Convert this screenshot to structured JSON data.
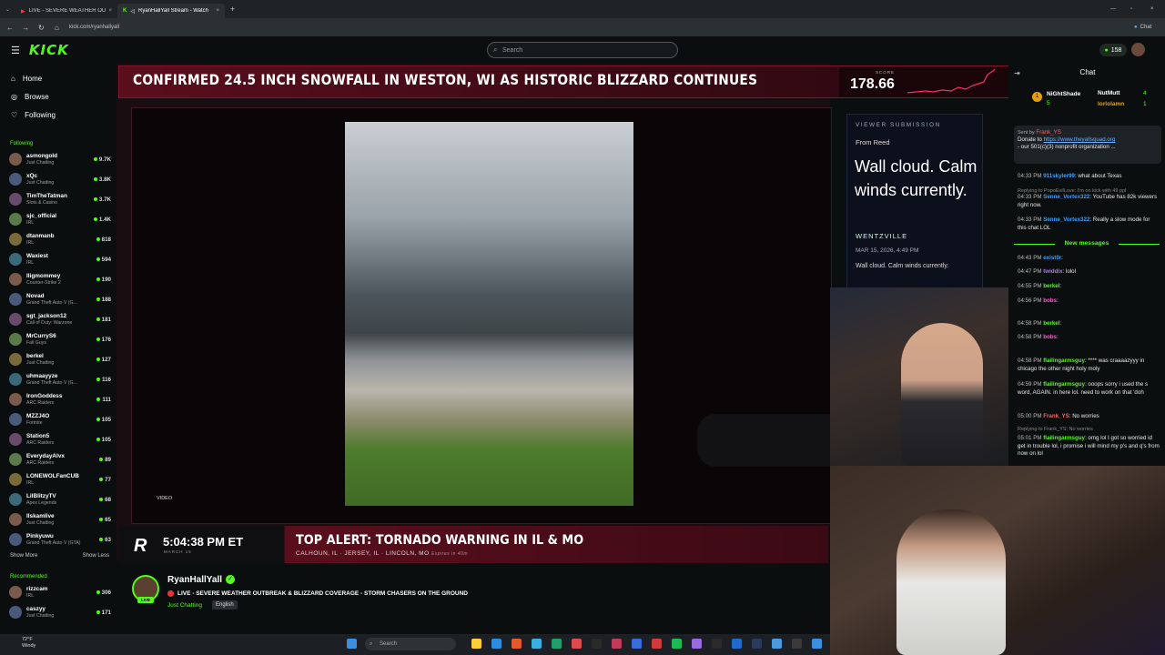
{
  "browser": {
    "tabs": [
      {
        "label": "LIVE - SEVERE WEATHER OUTB",
        "active": false
      },
      {
        "label": "RyanHallYall Stream - Watch",
        "active": true
      }
    ],
    "url": "kick.com/ryanhallyall",
    "chat_btn": "Chat"
  },
  "header": {
    "logo": "KICK",
    "search_placeholder": "Search",
    "points": "158"
  },
  "nav": {
    "home": "Home",
    "browse": "Browse",
    "following": "Following"
  },
  "sidebar": {
    "following_title": "Following",
    "following": [
      {
        "name": "asmongold",
        "cat": "Just Chatting",
        "count": "9.7K"
      },
      {
        "name": "xQc",
        "cat": "Just Chatting",
        "count": "3.8K"
      },
      {
        "name": "TimTheTatman",
        "cat": "Slots & Casino",
        "count": "3.7K"
      },
      {
        "name": "sjc_official",
        "cat": "IRL",
        "count": "1.4K"
      },
      {
        "name": "dtanmanb",
        "cat": "IRL",
        "count": "818"
      },
      {
        "name": "Waxiest",
        "cat": "IRL",
        "count": "594"
      },
      {
        "name": "lligmommey",
        "cat": "Counter-Strike 2",
        "count": "190"
      },
      {
        "name": "Novad",
        "cat": "Grand Theft Auto V (G...",
        "count": "188"
      },
      {
        "name": "sgt_jackson12",
        "cat": "Call of Duty: Warzone",
        "count": "181"
      },
      {
        "name": "MrCurryS6",
        "cat": "Fall Guys",
        "count": "176"
      },
      {
        "name": "berkel",
        "cat": "Just Chatting",
        "count": "127"
      },
      {
        "name": "uhmaayyze",
        "cat": "Grand Theft Auto V (G...",
        "count": "116"
      },
      {
        "name": "IronGoddess",
        "cat": "ARC Raiders",
        "count": "111"
      },
      {
        "name": "MZZJ4O",
        "cat": "Fortnite",
        "count": "105"
      },
      {
        "name": "Station5",
        "cat": "ARC Raiders",
        "count": "105"
      },
      {
        "name": "EverydayAlvx",
        "cat": "ARC Raiders",
        "count": "89"
      },
      {
        "name": "LONEWOLFanCUB",
        "cat": "IRL",
        "count": "77"
      },
      {
        "name": "LilBlitzyTV",
        "cat": "Apex Legends",
        "count": "68"
      },
      {
        "name": "llskamlive",
        "cat": "Just Chatting",
        "count": "65"
      },
      {
        "name": "Pinkyuwu",
        "cat": "Grand Theft Auto V (GTA)",
        "count": "63"
      }
    ],
    "show_more": "Show More",
    "show_less": "Show Less",
    "recommended_title": "Recommended",
    "recommended": [
      {
        "name": "rizzcam",
        "cat": "IRL",
        "count": "306"
      },
      {
        "name": "caszyy",
        "cat": "Just Chatting",
        "count": "171"
      }
    ]
  },
  "stream": {
    "headline": "CONFIRMED 24.5 INCH SNOWFALL IN WESTON, WI AS HISTORIC BLIZZARD CONTINUES",
    "score_label": "SCORE",
    "score": "178.66",
    "video_label": "VIDEO",
    "submission": {
      "header": "VIEWER SUBMISSION",
      "from": "From Reed",
      "big": "Wall cloud. Calm winds currently.",
      "location": "WENTZVILLE",
      "date": "MAR 15, 2026, 4:49 PM",
      "small": "Wall cloud. Calm winds currently."
    },
    "ticker": {
      "logo": "R",
      "time": "5:04:38 PM ET",
      "date": "MARCH 15",
      "alert": "TOP ALERT: TORNADO WARNING IN IL & MO",
      "places": "CALHOUN, IL · JERSEY, IL · LINCOLN, MO",
      "expires": "Expires in 40m"
    }
  },
  "streamer": {
    "name": "RyanHallYall",
    "live": "LIVE",
    "title": "LIVE - SEVERE WEATHER OUTBREAK & BLIZZARD COVERAGE - STORM CHASERS ON THE GROUND",
    "category": "Just Chatting",
    "language": "English"
  },
  "chat": {
    "title": "Chat",
    "leaderboard": [
      {
        "rank": "1",
        "name": "NiGhtShade",
        "count": "5"
      },
      {
        "name": "NutMutt",
        "count": "4"
      },
      {
        "name": "lorlolamn",
        "count": "1"
      }
    ],
    "pinned": {
      "sent_by": "Sent by",
      "user": "Frank_YS",
      "text1": "Donate to",
      "link": "https://www.theyallsquad.org",
      "text2": "- our 501(c)(3) nonprofit organization ..."
    },
    "new_messages": "New messages",
    "messages": [
      {
        "time": "04:33 PM",
        "user": "911skyler99",
        "color": "#3aa0ff",
        "text": ": what about Texas"
      },
      {
        "reply": "Replying to PopoEvilLove: I'm on kick with 49 ppl"
      },
      {
        "time": "04:33 PM",
        "user": "Senne_Vortex322",
        "color": "#3aa0ff",
        "text": ": YouTube has 82k viewers right now."
      },
      {
        "time": "04:33 PM",
        "user": "Senne_Vortex322",
        "color": "#3aa0ff",
        "text": ": Really a slow mode for this chat LOL"
      },
      {
        "time": "04:43 PM",
        "user": "exist0r",
        "color": "#3aa0ff",
        "text": ":"
      },
      {
        "time": "04:47 PM",
        "user": "twiddix",
        "color": "#b07aff",
        "text": ": lolol"
      },
      {
        "time": "04:55 PM",
        "user": "berkel",
        "color": "#53fc18",
        "text": ":"
      },
      {
        "time": "04:56 PM",
        "user": "bobs",
        "color": "#ff5ad1",
        "text": ":"
      },
      {
        "time": "04:58 PM",
        "user": "berkel",
        "color": "#53fc18",
        "text": ":"
      },
      {
        "time": "04:58 PM",
        "user": "bobs",
        "color": "#ff5ad1",
        "text": ":"
      },
      {
        "time": "04:58 PM",
        "user": "flailingarmsguy",
        "color": "#53fc18",
        "text": ": **** was craaaazyyy in chicago the other night holy moly"
      },
      {
        "time": "04:59 PM",
        "user": "flailingarmsguy",
        "color": "#53fc18",
        "text": ": ooops sorry i used the s word, AGAIN. in here lol. need to work on that 'doh"
      },
      {
        "time": "05:00 PM",
        "user": "Frank_YS",
        "color": "#e86a6a",
        "text": ": No worries"
      },
      {
        "reply": "Replying to Frank_YS: No worries"
      },
      {
        "time": "05:01 PM",
        "user": "flailingarmsguy",
        "color": "#53fc18",
        "text": ": omg lol I got so worried id get in trouble lol, i promise i will mind my p's and q's from now on lol"
      }
    ]
  },
  "taskbar": {
    "temp": "72°F",
    "weather": "Windy",
    "search": "Search"
  }
}
